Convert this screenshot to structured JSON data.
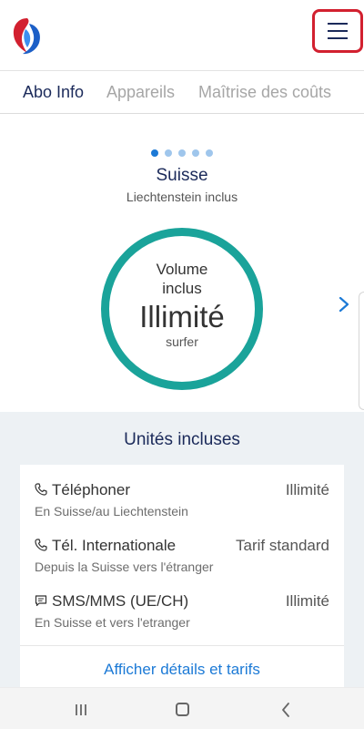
{
  "header": {
    "logo_icon": "swisscom-logo-icon",
    "menu_icon": "hamburger-menu-icon"
  },
  "tabs": [
    {
      "label": "Abo Info",
      "active": true
    },
    {
      "label": "Appareils",
      "active": false
    },
    {
      "label": "Maîtrise des coûts",
      "active": false
    }
  ],
  "carousel": {
    "total_pages": 5,
    "active_page": 1,
    "title": "Suisse",
    "subtitle": "Liechtenstein inclus",
    "ring": {
      "line1": "Volume",
      "line2": "inclus",
      "value": "Illimité",
      "sub": "surfer",
      "color": "#1aa39a"
    },
    "next_icon": "chevron-right-icon"
  },
  "units": {
    "title": "Unités incluses",
    "items": [
      {
        "icon": "phone-icon",
        "label": "Téléphoner",
        "value": "Illimité",
        "desc": "En Suisse/au Liechtenstein"
      },
      {
        "icon": "phone-icon",
        "label": "Tél. Internationale",
        "value": "Tarif standard",
        "desc": "Depuis la Suisse vers l'étranger"
      },
      {
        "icon": "message-icon",
        "label": "SMS/MMS (UE/CH)",
        "value": "Illimité",
        "desc": "En Suisse et vers l'etranger"
      }
    ],
    "details_link": "Afficher détails et tarifs"
  },
  "colors": {
    "brand_navy": "#1b2a5a",
    "accent_blue": "#1c7ad6",
    "ring_teal": "#1aa39a",
    "highlight_red": "#d2202f"
  },
  "navbar": {
    "recents_icon": "recents-icon",
    "home_icon": "home-icon",
    "back_icon": "back-icon"
  }
}
